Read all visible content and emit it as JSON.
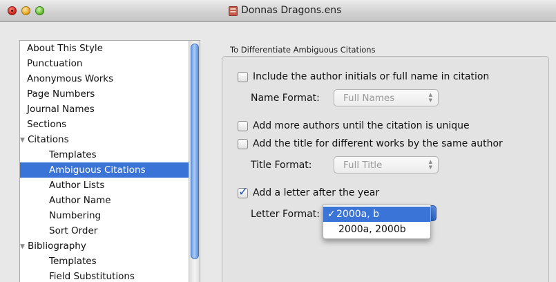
{
  "window": {
    "title": "Donnas Dragons.ens"
  },
  "sidebar": {
    "items": [
      {
        "label": "About This Style"
      },
      {
        "label": "Punctuation"
      },
      {
        "label": "Anonymous Works"
      },
      {
        "label": "Page Numbers"
      },
      {
        "label": "Journal Names"
      },
      {
        "label": "Sections"
      },
      {
        "label": "Citations",
        "expanded": true
      },
      {
        "label": "Templates"
      },
      {
        "label": "Ambiguous Citations",
        "selected": true
      },
      {
        "label": "Author Lists"
      },
      {
        "label": "Author Name"
      },
      {
        "label": "Numbering"
      },
      {
        "label": "Sort Order"
      },
      {
        "label": "Bibliography",
        "expanded": true
      },
      {
        "label": "Templates"
      },
      {
        "label": "Field Substitutions"
      }
    ]
  },
  "panel": {
    "group_title": "To Differentiate Ambiguous Citations",
    "include_initials": {
      "label": "Include the author initials or full name in citation",
      "checked": false
    },
    "name_format": {
      "label": "Name Format:",
      "value": "Full Names"
    },
    "add_authors": {
      "label": "Add more authors until the citation is unique",
      "checked": false
    },
    "add_title": {
      "label": "Add the title for different works by the same author",
      "checked": false
    },
    "title_format": {
      "label": "Title Format:",
      "value": "Full Title"
    },
    "add_letter": {
      "label": "Add a letter after the year",
      "checked": true
    },
    "letter_format": {
      "label": "Letter Format:",
      "options": [
        "2000a, b",
        "2000a, 2000b"
      ],
      "selected": "2000a, b"
    }
  },
  "icons": {
    "check": "✓",
    "disclosure_open": "▼",
    "popup_arrows_up": "▲",
    "popup_arrows_down": "▼"
  },
  "colors": {
    "selection": "#3a74d6",
    "scrollbar": "#6d9fe3"
  }
}
